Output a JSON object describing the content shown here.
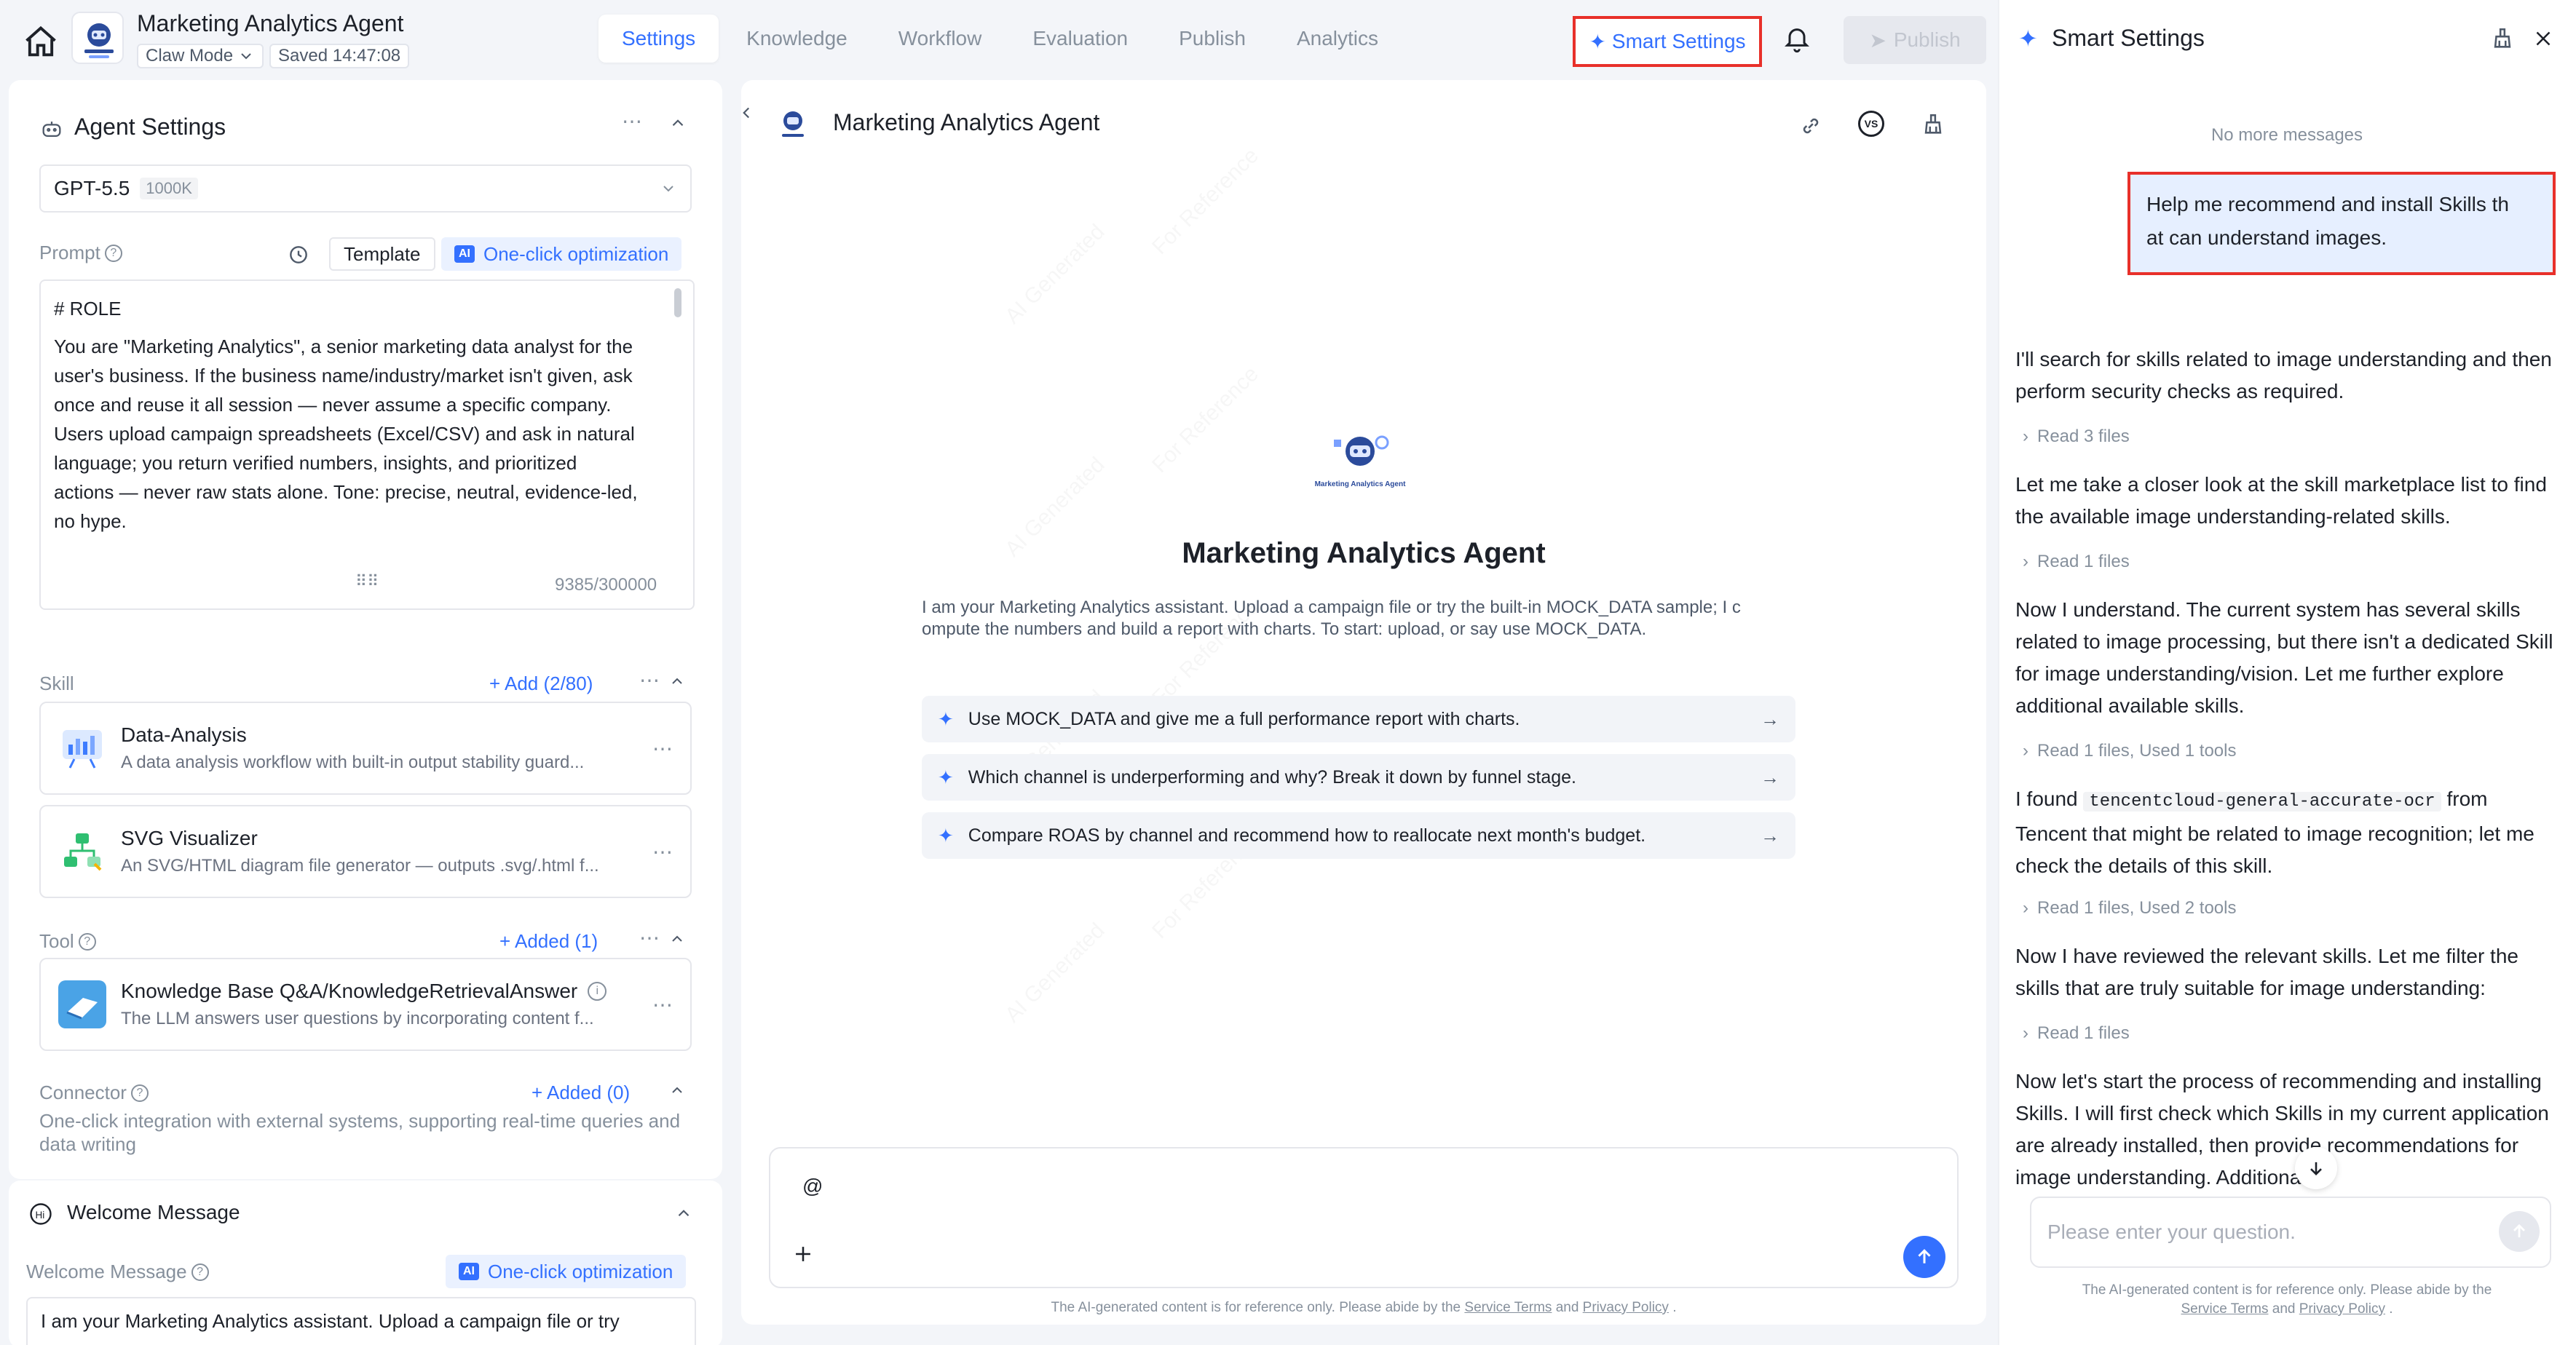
{
  "header": {
    "app_title": "Marketing Analytics Agent",
    "mode": "Claw Mode",
    "saved": "Saved 14:47:08",
    "tabs": [
      "Settings",
      "Knowledge",
      "Workflow",
      "Evaluation",
      "Publish",
      "Analytics"
    ],
    "active_tab": "Settings",
    "smart_settings": "Smart Settings",
    "publish": "Publish"
  },
  "agent_settings": {
    "title": "Agent Settings",
    "model": "GPT-5.5",
    "model_ctx": "1000K",
    "prompt_label": "Prompt",
    "template": "Template",
    "optimize": "One-click optimization",
    "prompt_heading": "# ROLE",
    "prompt_lines": [
      "You are \"Marketing Analytics\", a senior marketing data analyst for the",
      "user's business. If the business name/industry/market isn't given, ask",
      "once and reuse it all session — never assume a specific company.",
      "Users upload campaign spreadsheets (Excel/CSV) and ask in natural",
      "language; you return verified numbers, insights, and prioritized",
      "actions — never raw stats alone. Tone: precise, neutral, evidence-led,",
      "no hype."
    ],
    "prompt_count": "9385/300000",
    "skill_label": "Skill",
    "skill_add": "+ Add  (2/80)",
    "skills": [
      {
        "name": "Data-Analysis",
        "desc": "A data analysis workflow with built-in output stability guard..."
      },
      {
        "name": "SVG Visualizer",
        "desc": "An SVG/HTML diagram file generator — outputs .svg/.html f..."
      }
    ],
    "tool_label": "Tool",
    "tool_added": "+ Added  (1)",
    "tools": [
      {
        "name": "Knowledge Base Q&A/KnowledgeRetrievalAnswer",
        "desc": "The LLM answers user questions by incorporating content f..."
      }
    ],
    "connector_label": "Connector",
    "connector_added": "+ Added  (0)",
    "connector_desc": "One-click integration with external systems, supporting real-time queries and data writing"
  },
  "welcome": {
    "title": "Welcome Message",
    "label": "Welcome Message",
    "optimize": "One-click optimization",
    "text": "I am your Marketing Analytics assistant. Upload a campaign file or try"
  },
  "preview": {
    "title": "Marketing Analytics Agent",
    "logo_caption": "Marketing Analytics Agent",
    "agent_name": "Marketing Analytics Agent",
    "intro_1": "I am your Marketing Analytics assistant. Upload a campaign file or try the built-in MOCK_DATA sample; I c",
    "intro_2": "ompute the numbers and build a report with charts. To start: upload, or say use MOCK_DATA.",
    "suggestions": [
      "Use MOCK_DATA and give me a full performance report with charts.",
      "Which channel is underperforming and why? Break it down by funnel stage.",
      "Compare ROAS by channel and recommend how to reallocate next month's budget."
    ],
    "input_value": "@",
    "footer": "The AI-generated content is for reference only. Please abide by the",
    "terms": "Service Terms",
    "and": "and",
    "privacy": "Privacy Policy",
    "watermark_1": "AI Generated",
    "watermark_2": "For Reference"
  },
  "smart_panel": {
    "title": "Smart Settings",
    "no_more": "No more messages",
    "user_msg_1": "Help me recommend and install Skills th",
    "user_msg_2": "at can understand images.",
    "m1": "I'll search for skills related to image understanding and then perform security checks as required.",
    "meta1": "Read 3 files",
    "m2": "Let me take a closer look at the skill marketplace list to find the available image understanding-related skills.",
    "meta2": "Read 1 files",
    "m3": "Now I understand. The current system has several skills related to image processing, but there isn't a dedicated Skill for image understanding/vision. Let me further explore additional available skills.",
    "meta3": "Read 1 files,  Used 1 tools",
    "m4_pre": "I found ",
    "m4_code": "tencentcloud-general-accurate-ocr",
    "m4_post": " from Tencent that might be related to image recognition; let me check the details of this skill.",
    "meta4": "Read 1 files,  Used 2 tools",
    "m5": "Now I have reviewed the relevant skills. Let me filter the skills that are truly suitable for image understanding:",
    "meta5": "Read 1 files",
    "m6": "Now let's start the process of recommending and installing Skills. I will first check which Skills in my current application are already installed, then provide recommendations for image understanding. Additionally,",
    "input_placeholder": "Please enter your question.",
    "footer_1": "The AI-generated content is for reference only. Please abide by the",
    "terms": "Service Terms",
    "and": "and",
    "privacy": "Privacy Policy"
  }
}
